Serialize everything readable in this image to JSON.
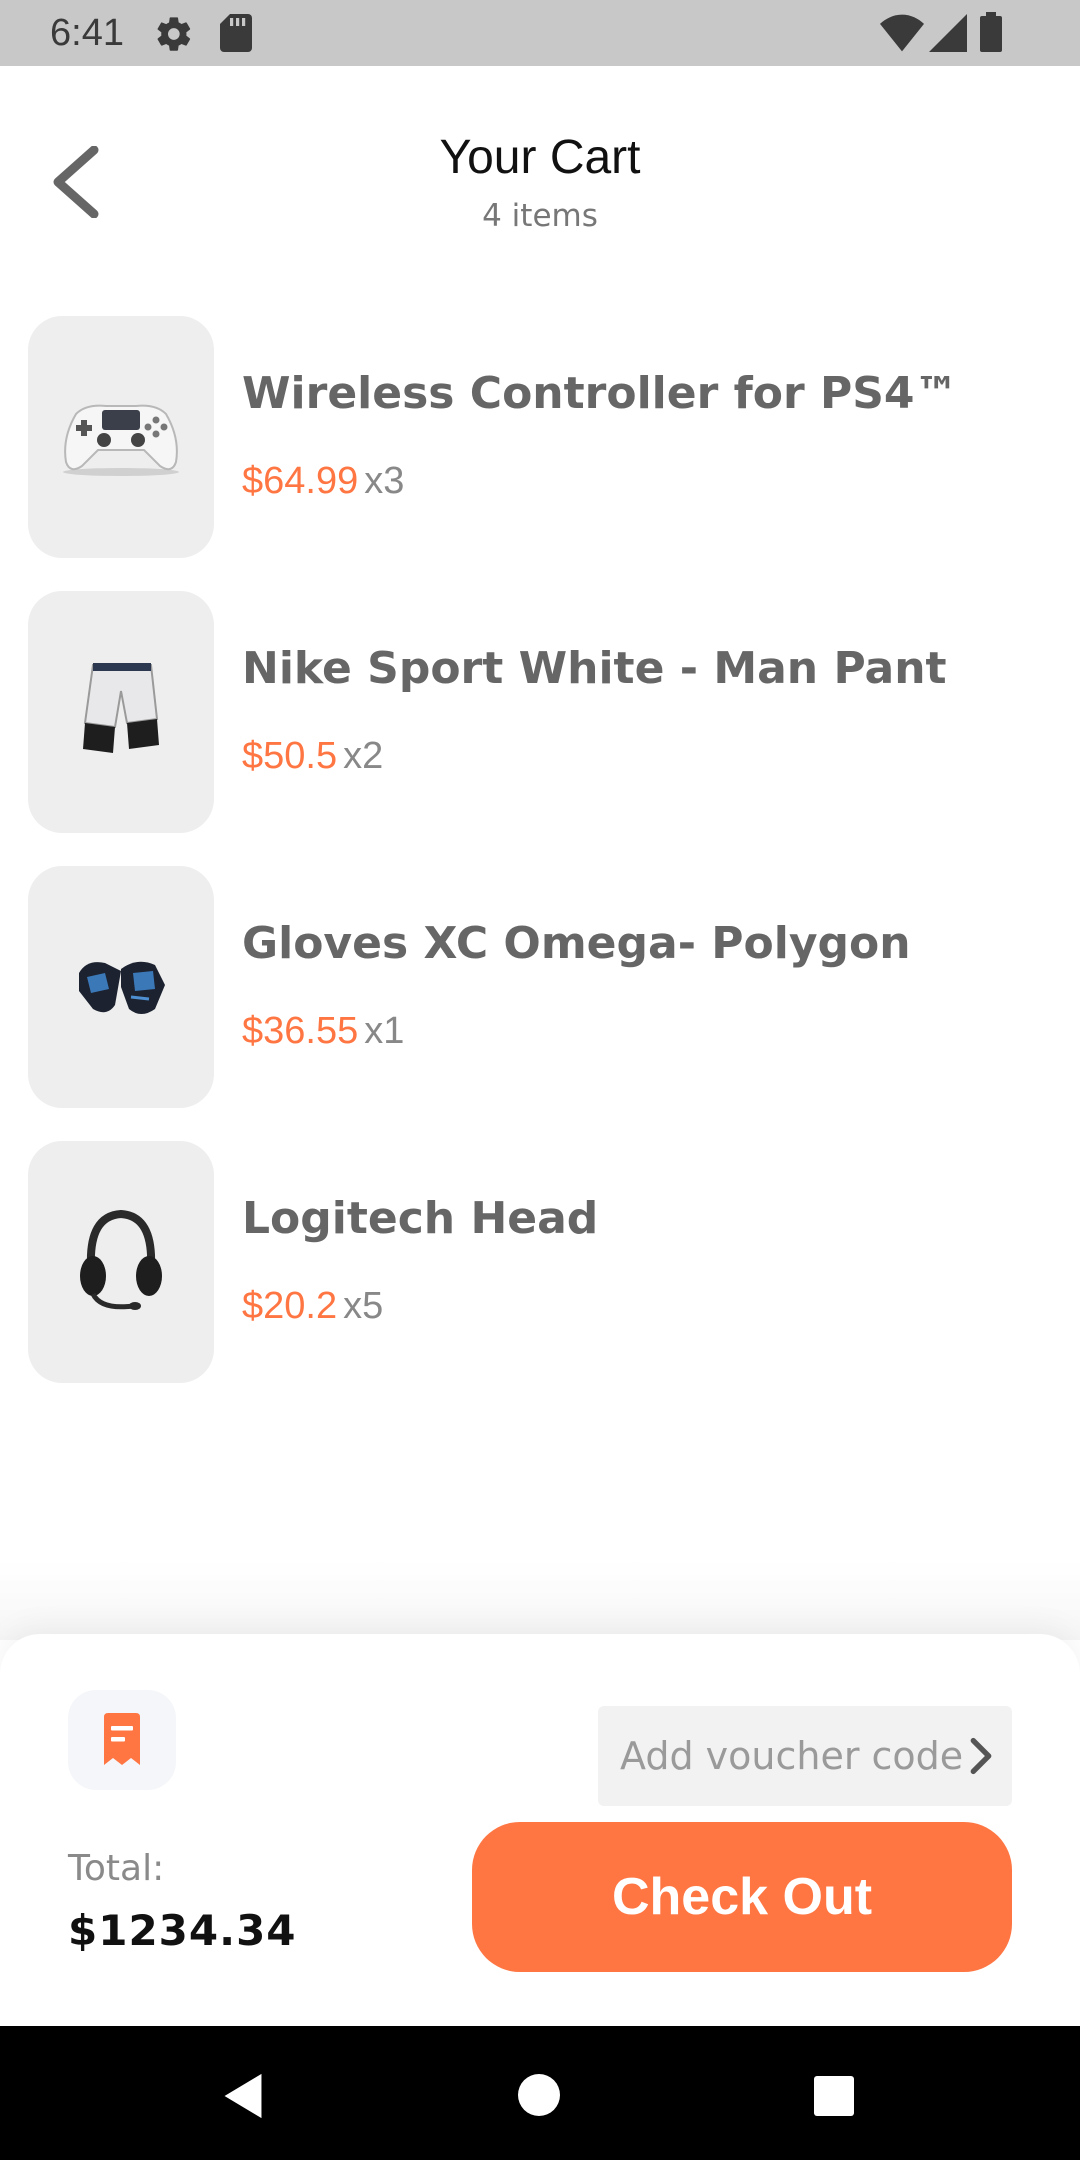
{
  "status_bar": {
    "time": "6:41",
    "icons": [
      "gear-icon",
      "sd-card-icon",
      "wifi-icon",
      "signal-icon",
      "battery-icon"
    ]
  },
  "header": {
    "title": "Your Cart",
    "subtitle": "4 items",
    "back_icon": "chevron-left-icon"
  },
  "cart": {
    "items": [
      {
        "name": "Wireless Controller for PS4™",
        "price": "$64.99",
        "qty": "x3",
        "image": "game-controller-image"
      },
      {
        "name": "Nike Sport White - Man Pant",
        "price": "$50.5",
        "qty": "x2",
        "image": "shorts-image"
      },
      {
        "name": "Gloves XC Omega- Polygon",
        "price": "$36.55",
        "qty": "x1",
        "image": "gloves-image"
      },
      {
        "name": "Logitech Head",
        "price": "$20.2",
        "qty": "x5",
        "image": "headset-image"
      }
    ]
  },
  "checkout": {
    "voucher_placeholder": "Add voucher code",
    "total_label": "Total:",
    "total_value": "$1234.34",
    "button_label": "Check Out"
  },
  "colors": {
    "accent": "#ff7643",
    "thumb_bg": "#eeeeee",
    "status_bar": "#c8c8c8"
  }
}
